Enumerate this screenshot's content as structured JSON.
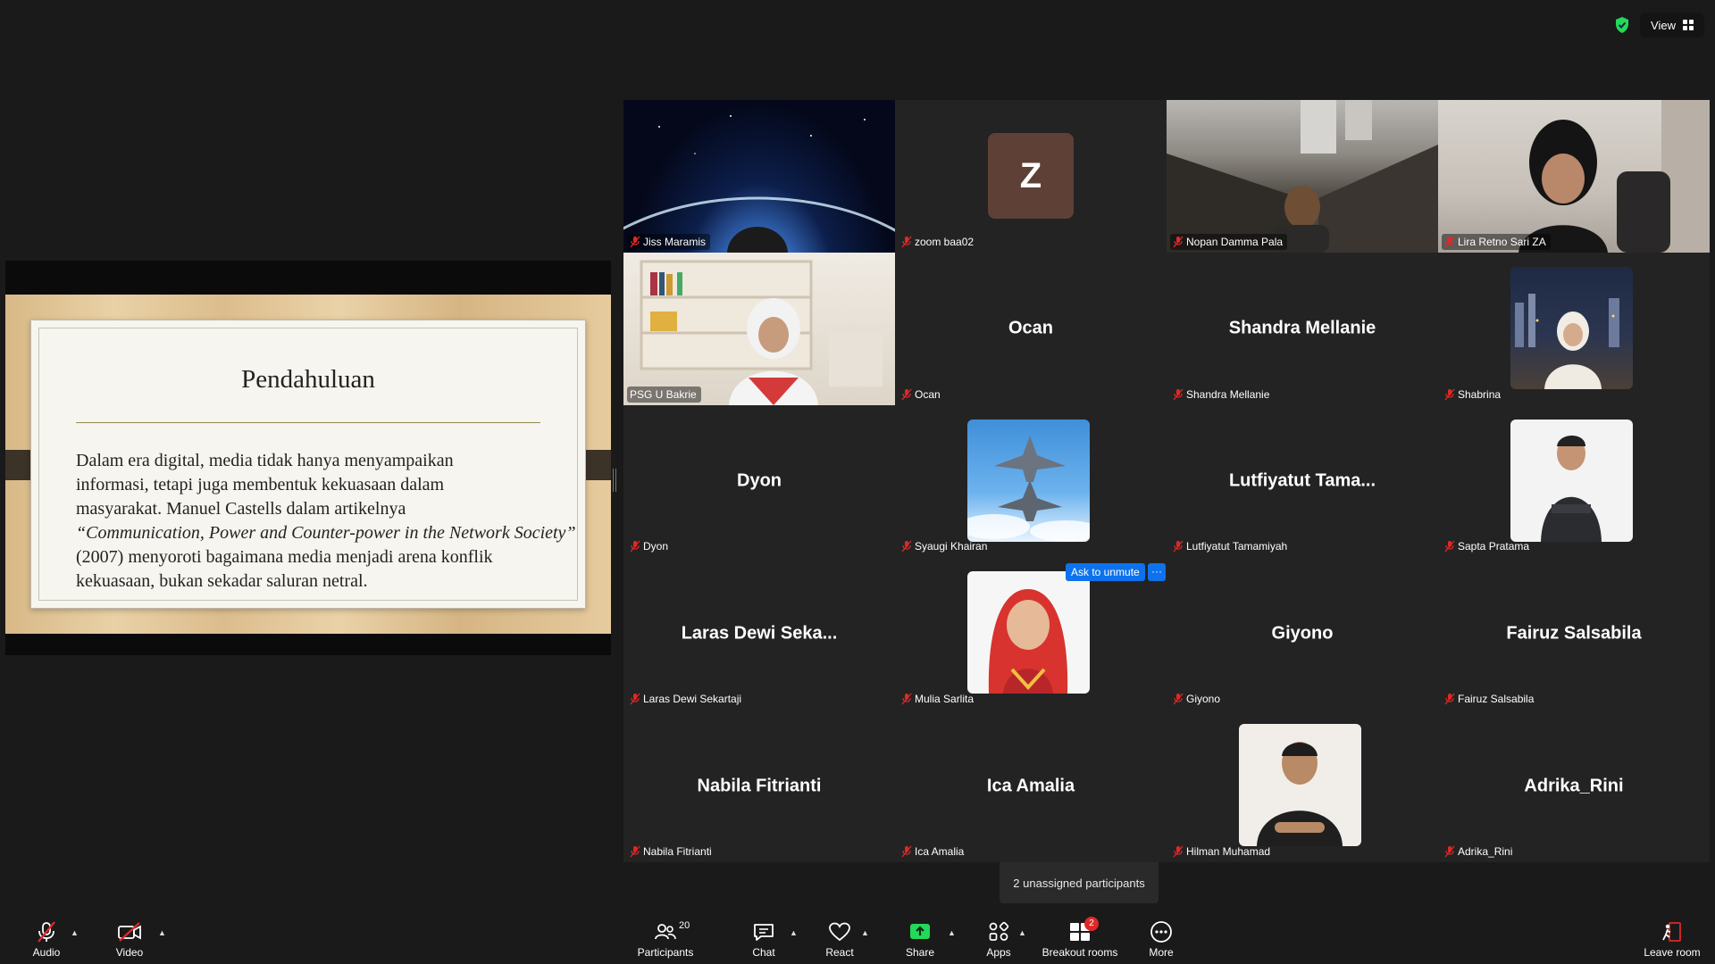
{
  "top": {
    "view_label": "View"
  },
  "slide": {
    "title": "Pendahuluan",
    "lines": [
      "Dalam era digital, media tidak hanya menyampaikan",
      "informasi, tetapi juga membentuk kekuasaan dalam",
      "masyarakat. Manuel Castells dalam artikelnya",
      "“Communication, Power and Counter-power in the Network Society”",
      "(2007) menyoroti bagaimana media menjadi arena konflik",
      "kekuasaan, bukan sekadar saluran netral."
    ]
  },
  "participants": [
    {
      "name": "Jiss Maramis"
    },
    {
      "name": "zoom baa02",
      "avatar_letter": "Z"
    },
    {
      "name": "Nopan Damma Pala"
    },
    {
      "name": "Lira Retno Sari ZA"
    },
    {
      "name": "PSG U Bakrie"
    },
    {
      "name": "Ocan",
      "display": "Ocan"
    },
    {
      "name": "Shandra Mellanie",
      "display": "Shandra Mellanie"
    },
    {
      "name": "Shabrina"
    },
    {
      "name": "Dyon",
      "display": "Dyon"
    },
    {
      "name": "Syaugi Khairan"
    },
    {
      "name": "Lutfiyatut Tamamiyah",
      "display": "Lutfiyatut  Tama..."
    },
    {
      "name": "Sapta Pratama"
    },
    {
      "name": "Laras Dewi Sekartaji",
      "display": "Laras Dewi Seka..."
    },
    {
      "name": "Mulia Sarlita"
    },
    {
      "name": "Giyono",
      "display": "Giyono"
    },
    {
      "name": "Fairuz Salsabila",
      "display": "Fairuz Salsabila"
    },
    {
      "name": "Nabila Fitrianti",
      "display": "Nabila Fitrianti"
    },
    {
      "name": "Ica Amalia",
      "display": "Ica Amalia"
    },
    {
      "name": "Hilman Muhamad"
    },
    {
      "name": "Adrika_Rini",
      "display": "Adrika_Rini"
    }
  ],
  "hover": {
    "ask_unmute": "Ask to unmute",
    "more": "···"
  },
  "unassigned": "2 unassigned participants",
  "toolbar": {
    "audio": "Audio",
    "video": "Video",
    "participants": "Participants",
    "participants_count": "20",
    "chat": "Chat",
    "react": "React",
    "share": "Share",
    "apps": "Apps",
    "breakout": "Breakout rooms",
    "breakout_badge": "2",
    "more": "More",
    "leave": "Leave room"
  },
  "colors": {
    "active_speaker": "#23d959",
    "share_green": "#23d959",
    "accent_blue": "#0e72ed",
    "badge_red": "#e02828",
    "avatar_z": "#5e4036"
  },
  "icons": [
    "shield-check-icon",
    "grid-view-icon",
    "mic-off-icon",
    "video-off-icon",
    "participants-icon",
    "chat-icon",
    "heart-icon",
    "share-arrow-icon",
    "apps-icon",
    "breakout-grid-icon",
    "more-icon",
    "leave-icon"
  ]
}
